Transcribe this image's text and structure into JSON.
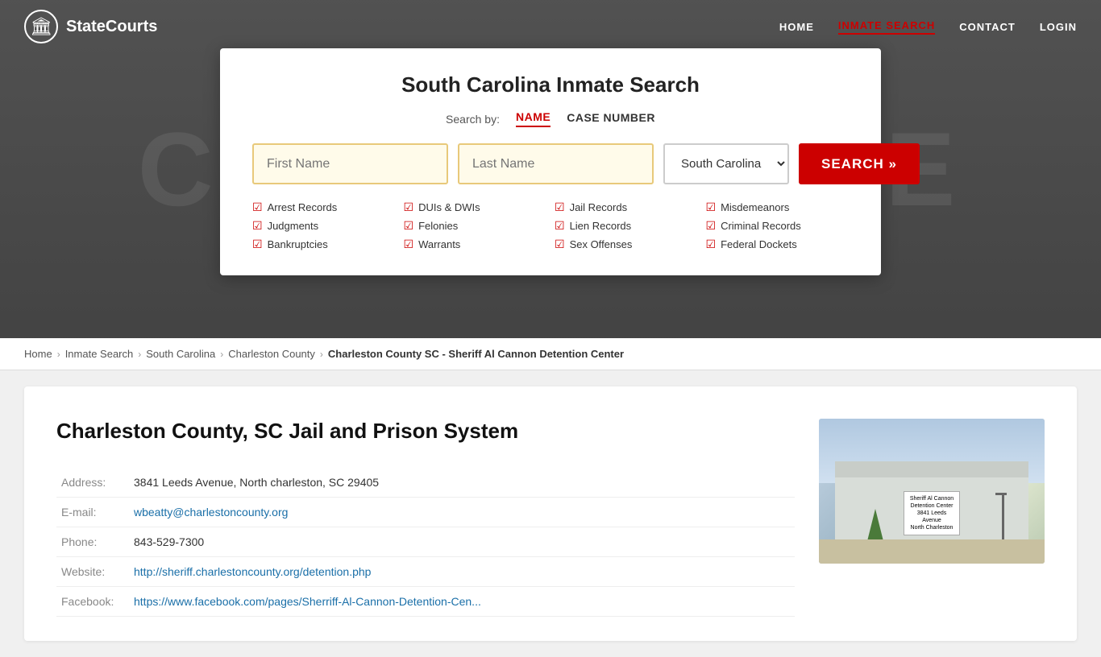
{
  "site": {
    "logo_text": "StateCourts",
    "logo_icon": "🏛"
  },
  "navbar": {
    "links": [
      {
        "label": "HOME",
        "active": false
      },
      {
        "label": "INMATE SEARCH",
        "active": true
      },
      {
        "label": "CONTACT",
        "active": false
      },
      {
        "label": "LOGIN",
        "active": false
      }
    ]
  },
  "hero": {
    "bg_text": "COURTHOUSE"
  },
  "modal": {
    "title": "South Carolina Inmate Search",
    "search_by_label": "Search by:",
    "tab_name": "NAME",
    "tab_case": "CASE NUMBER",
    "first_name_placeholder": "First Name",
    "last_name_placeholder": "Last Name",
    "state_value": "South Carolina",
    "search_btn": "SEARCH »",
    "checkboxes": [
      "Arrest Records",
      "Judgments",
      "Bankruptcies",
      "DUIs & DWIs",
      "Felonies",
      "Warrants",
      "Jail Records",
      "Lien Records",
      "Sex Offenses",
      "Misdemeanors",
      "Criminal Records",
      "Federal Dockets"
    ]
  },
  "breadcrumb": {
    "items": [
      {
        "label": "Home",
        "link": true
      },
      {
        "label": "Inmate Search",
        "link": true
      },
      {
        "label": "South Carolina",
        "link": true
      },
      {
        "label": "Charleston County",
        "link": true
      },
      {
        "label": "Charleston County SC - Sheriff Al Cannon Detention Center",
        "link": false
      }
    ]
  },
  "facility": {
    "title": "Charleston County, SC Jail and Prison System",
    "address_label": "Address:",
    "address_value": "3841 Leeds Avenue, North charleston, SC 29405",
    "email_label": "E-mail:",
    "email_value": "wbeatty@charlestoncounty.org",
    "phone_label": "Phone:",
    "phone_value": "843-529-7300",
    "website_label": "Website:",
    "website_value": "http://sheriff.charlestoncounty.org/detention.php",
    "facebook_label": "Facebook:",
    "facebook_value": "https://www.facebook.com/pages/Sherriff-Al-Cannon-Detention-Cen...",
    "sign_text": "Sheriff Al Cannon\nDetention Center\n3841 Leeds Avenue\nNorth Charleston"
  }
}
